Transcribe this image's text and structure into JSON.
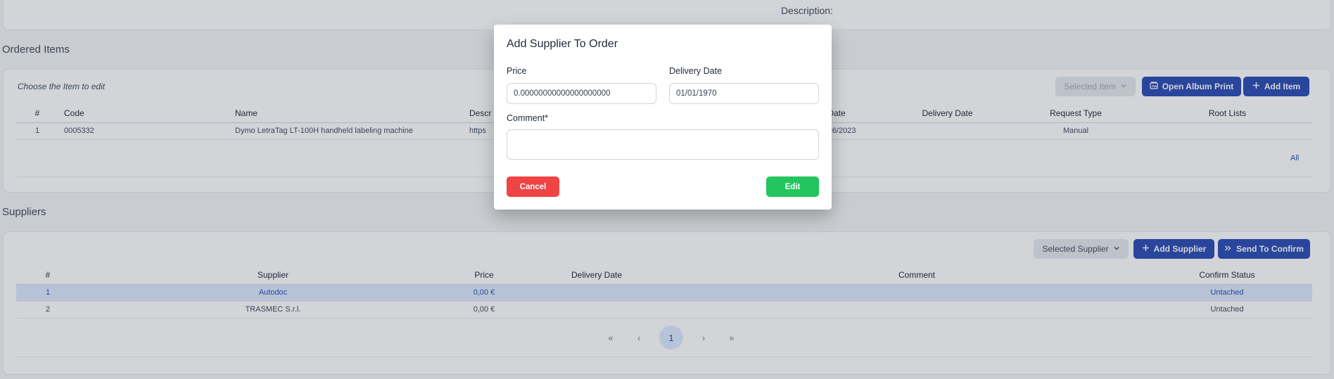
{
  "top": {
    "description_label": "Description:"
  },
  "ordered_items": {
    "section_title": "Ordered Items",
    "choose_label": "Choose the Item to edit",
    "selected_item_label": "Selected Item",
    "open_album_label": "Open Album Print",
    "add_item_label": "Add Item",
    "columns": [
      "#",
      "Code",
      "Name",
      "Descr",
      "Date",
      "Delivery Date",
      "Request Type",
      "Root Lists"
    ],
    "rows": [
      {
        "num": "1",
        "code": "0005332",
        "name": "Dymo LetraTag LT-100H handheld labeling machine",
        "desc": "https",
        "date": "02/06/2023",
        "delivery": "",
        "request_type": "Manual",
        "root_lists": ""
      }
    ],
    "all_link": "All"
  },
  "suppliers": {
    "section_title": "Suppliers",
    "selected_supplier_label": "Selected Supplier",
    "add_supplier_label": "Add Supplier",
    "send_confirm_label": "Send To Confirm",
    "columns": [
      "#",
      "Supplier",
      "Price",
      "Delivery Date",
      "Comment",
      "Confirm Status"
    ],
    "rows": [
      {
        "num": "1",
        "supplier": "Autodoc",
        "price": "0,00 €",
        "delivery": "",
        "comment": "",
        "status": "Untached"
      },
      {
        "num": "2",
        "supplier": "TRASMEC S.r.l.",
        "price": "0,00 €",
        "delivery": "",
        "comment": "",
        "status": "Untached"
      }
    ],
    "pagination": {
      "first": "«",
      "prev": "‹",
      "current": "1",
      "next": "›",
      "last": "»"
    }
  },
  "modal": {
    "title": "Add Supplier To Order",
    "price_label": "Price",
    "price_value": "0.00000000000000000000",
    "delivery_label": "Delivery Date",
    "delivery_value": "01/01/1970",
    "comment_label": "Comment*",
    "comment_value": "",
    "cancel_label": "Cancel",
    "edit_label": "Edit"
  },
  "colors": {
    "primary": "#1e40af",
    "danger": "#ef4444",
    "success": "#22c55e",
    "highlight": "#dbeafe"
  }
}
